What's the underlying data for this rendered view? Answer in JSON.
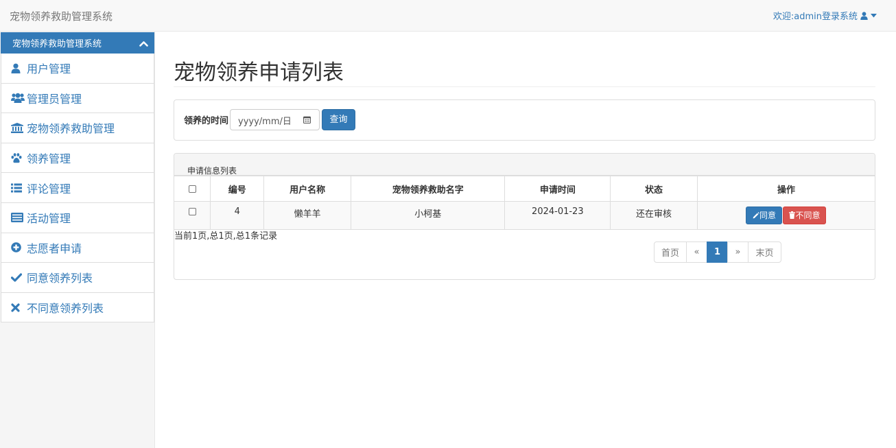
{
  "app": {
    "brand": "宠物领养救助管理系统",
    "user_menu": "欢迎:admin登录系统"
  },
  "sidebar": {
    "header": "宠物领养救助管理系统",
    "items": [
      {
        "icon": "user-icon",
        "label": "用户管理"
      },
      {
        "icon": "users-icon",
        "label": "管理员管理"
      },
      {
        "icon": "institution-icon",
        "label": "宠物领养救助管理"
      },
      {
        "icon": "paw-icon",
        "label": "领养管理"
      },
      {
        "icon": "list-icon",
        "label": "评论管理"
      },
      {
        "icon": "card-list-icon",
        "label": "活动管理"
      },
      {
        "icon": "plus-circle-icon",
        "label": "志愿者申请"
      },
      {
        "icon": "check-icon",
        "label": "同意领养列表"
      },
      {
        "icon": "times-icon",
        "label": "不同意领养列表"
      }
    ]
  },
  "main": {
    "title": "宠物领养申请列表",
    "search": {
      "label": "领养的时间",
      "date_placeholder": "yyyy/mm/日",
      "button": "查询"
    },
    "list": {
      "heading": "申请信息列表",
      "columns": [
        "编号",
        "用户名称",
        "宠物领养救助名字",
        "申请时间",
        "状态",
        "操作"
      ],
      "rows": [
        {
          "id": "4",
          "user": "懒羊羊",
          "pet": "小柯基",
          "date": "2024-01-23",
          "status": "还在审核",
          "agree": "同意",
          "reject": "不同意"
        }
      ],
      "page_info": "当前1页,总1页,总1条记录"
    },
    "pager": {
      "first": "首页",
      "prev": "«",
      "current": "1",
      "next": "»",
      "last": "末页"
    }
  },
  "colors": {
    "primary": "#337ab7",
    "danger": "#d9534f",
    "navbar_bg": "#f8f8f8",
    "sidebar_bg": "#f5f5f5"
  }
}
